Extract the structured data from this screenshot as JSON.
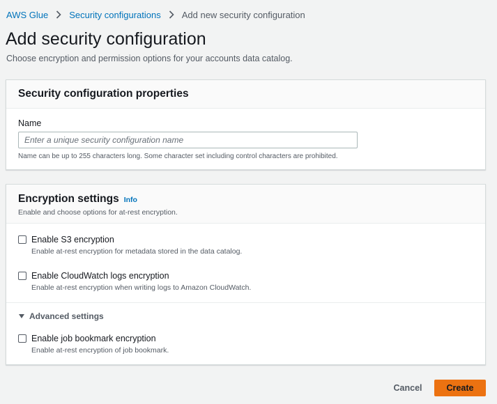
{
  "breadcrumb": {
    "items": [
      "AWS Glue",
      "Security configurations"
    ],
    "current": "Add new security configuration"
  },
  "page": {
    "title": "Add security configuration",
    "description": "Choose encryption and permission options for your accounts data catalog."
  },
  "properties_panel": {
    "title": "Security configuration properties",
    "name_label": "Name",
    "name_value": "",
    "name_placeholder": "Enter a unique security configuration name",
    "name_hint": "Name can be up to 255 characters long. Some character set including control characters are prohibited."
  },
  "encryption_panel": {
    "title": "Encryption settings",
    "info_link": "Info",
    "description": "Enable and choose options for at-rest encryption.",
    "options": [
      {
        "label": "Enable S3 encryption",
        "description": "Enable at-rest encryption for metadata stored in the data catalog.",
        "checked": false
      },
      {
        "label": "Enable CloudWatch logs encryption",
        "description": "Enable at-rest encryption when writing logs to Amazon CloudWatch.",
        "checked": false
      }
    ],
    "advanced_label": "Advanced settings",
    "advanced_options": [
      {
        "label": "Enable job bookmark encryption",
        "description": "Enable at-rest encryption of job bookmark.",
        "checked": false
      }
    ]
  },
  "actions": {
    "cancel": "Cancel",
    "create": "Create"
  },
  "colors": {
    "link": "#0073bb",
    "primary_button": "#ec7211",
    "page_background": "#f2f3f3"
  }
}
